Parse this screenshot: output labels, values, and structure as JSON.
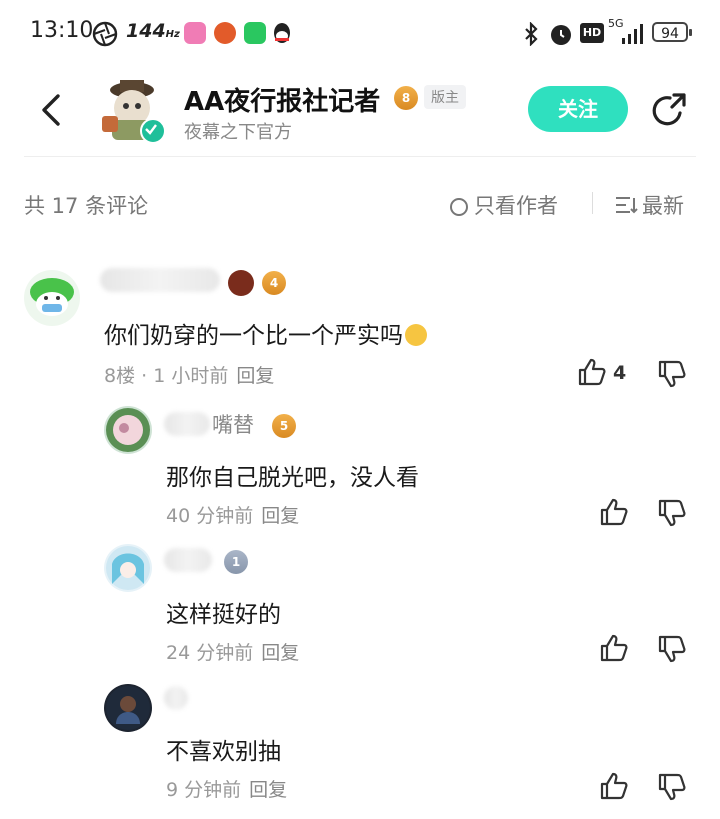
{
  "status_bar": {
    "time": "13:10",
    "refresh": "144",
    "battery": "94",
    "network": "5G"
  },
  "header": {
    "title": "AA夜行报社记者",
    "level": "8",
    "role_badge": "版主",
    "subtitle": "夜幕之下官方",
    "follow_label": "关注"
  },
  "filter": {
    "count_label": "共 17 条评论",
    "only_author_label": "只看作者",
    "sort_label": "最新"
  },
  "comments": [
    {
      "username": "",
      "level": "4",
      "text": "你们奶穿的一个比一个严实吗",
      "floor": "8楼 · 1 小时前",
      "reply_label": "回复",
      "likes": "4"
    },
    {
      "username": "嘴替",
      "level": "5",
      "text": "那你自己脱光吧，没人看",
      "time": "40 分钟前",
      "reply_label": "回复"
    },
    {
      "username": "",
      "level": "1",
      "text": "这样挺好的",
      "time": "24 分钟前",
      "reply_label": "回复"
    },
    {
      "username": "",
      "level": "",
      "text": "不喜欢别抽",
      "time": "9 分钟前",
      "reply_label": "回复"
    }
  ],
  "colors": {
    "accent": "#2fe0bf",
    "level_badge": "#e39a2e",
    "muted": "#999999"
  }
}
